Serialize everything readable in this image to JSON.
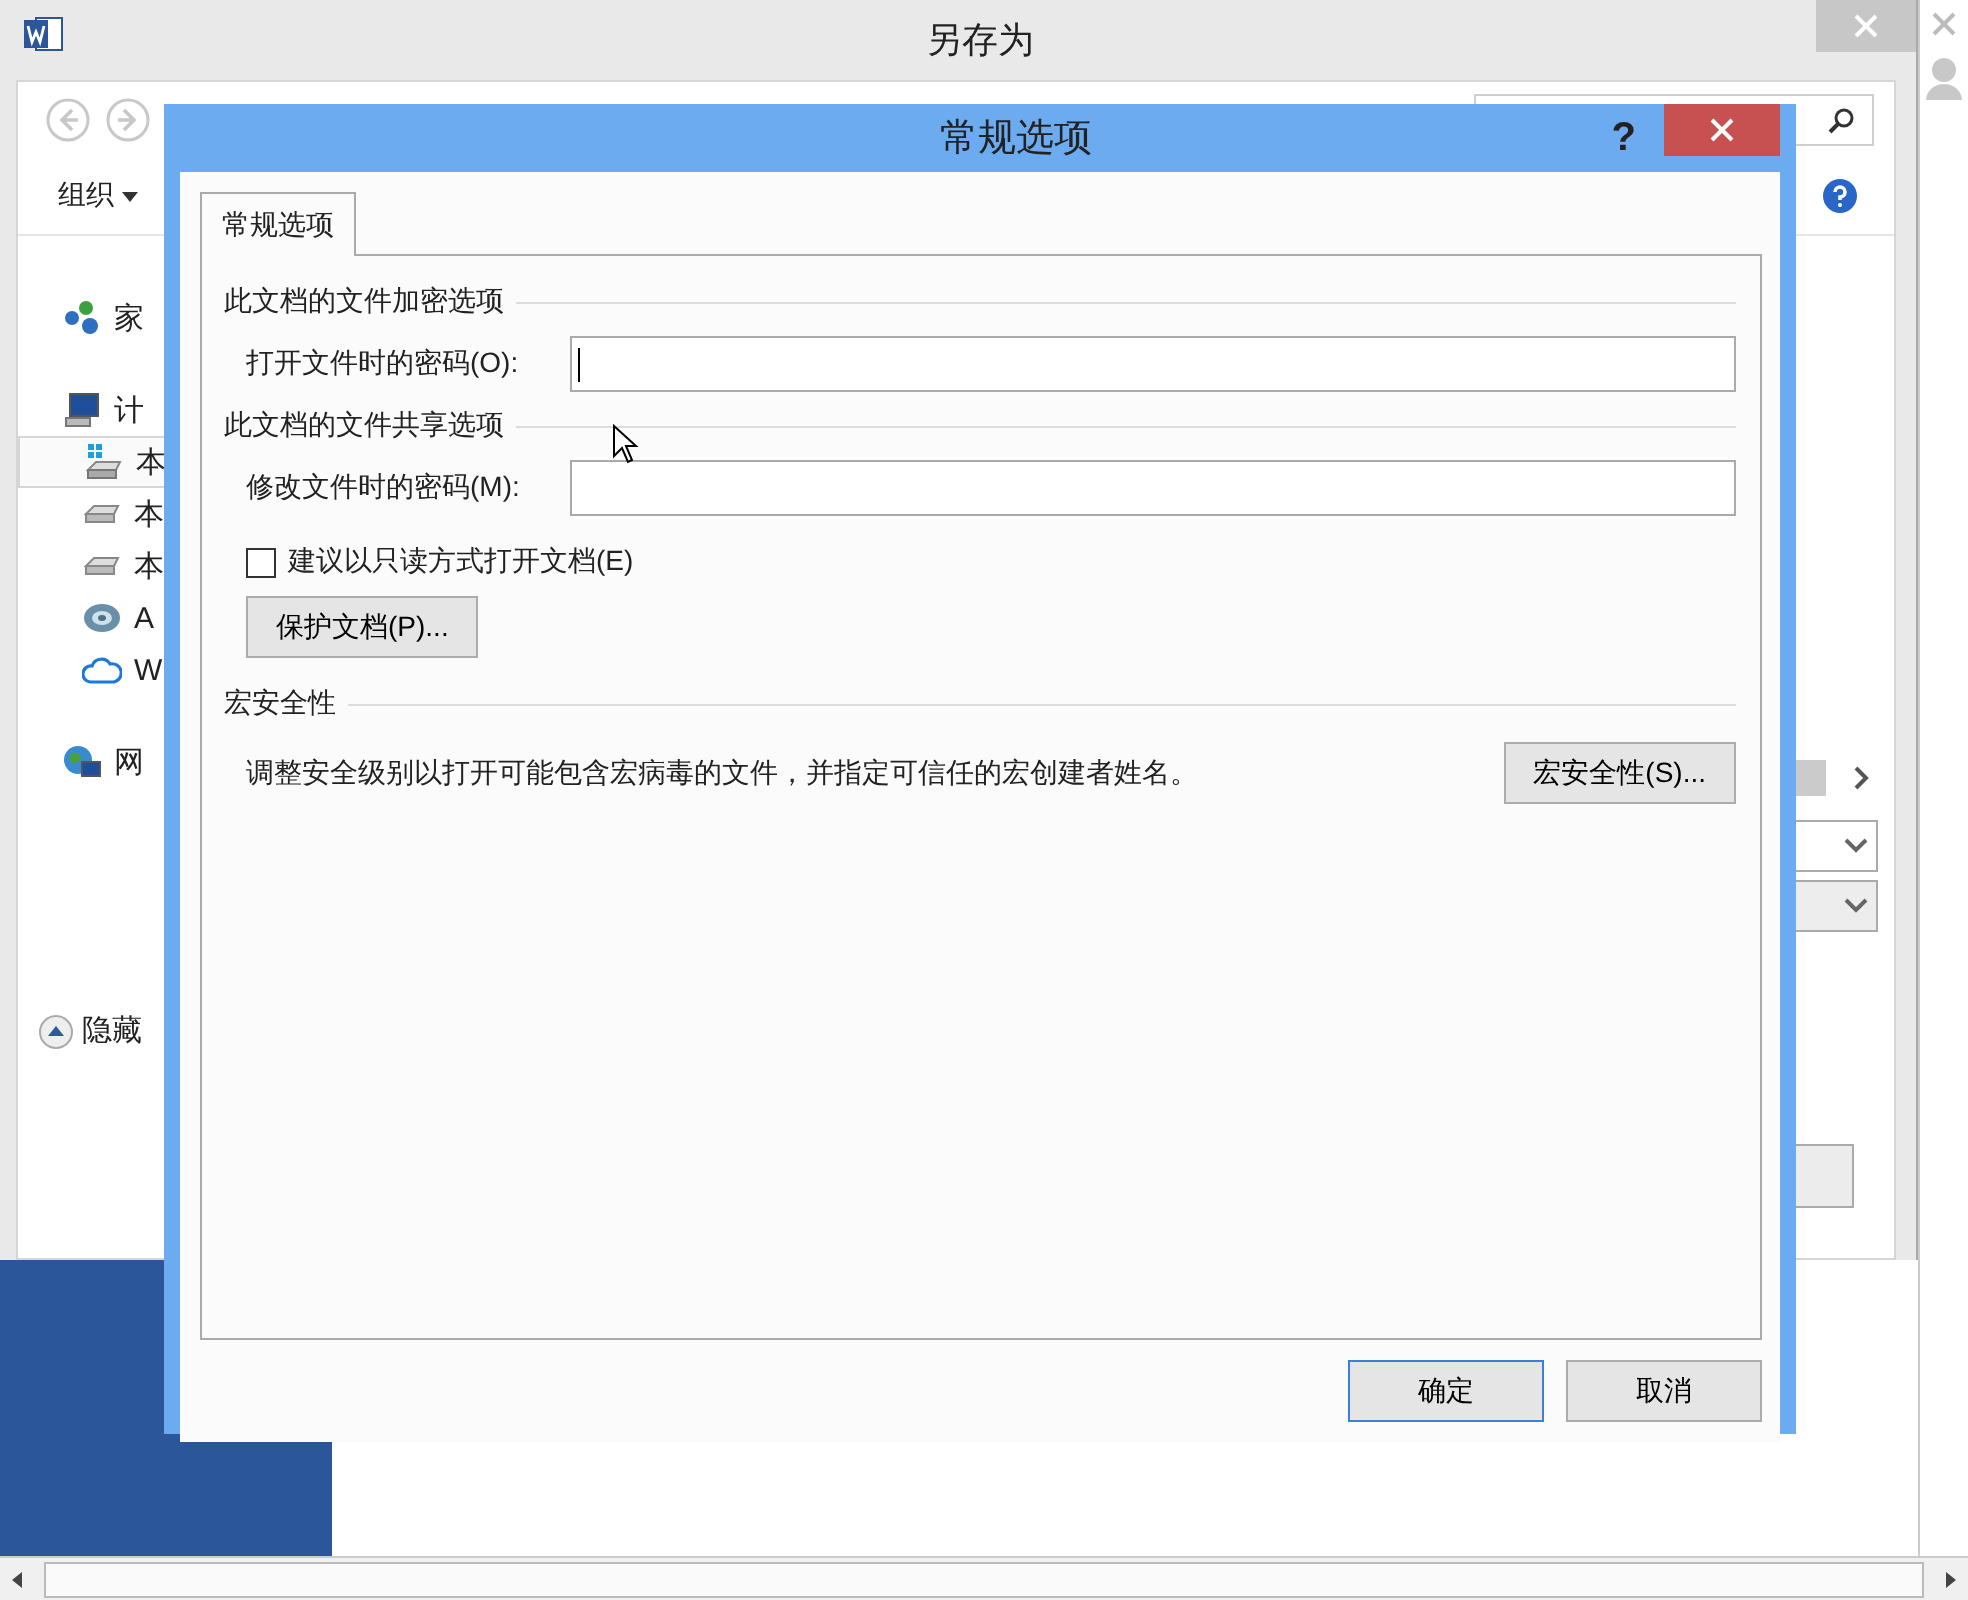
{
  "back_window": {
    "title": "另存为",
    "toolbar": {
      "organize": "组织"
    },
    "sidebar": [
      {
        "label": "家",
        "kind": "homegroup",
        "selected": false
      },
      {
        "label": "计",
        "kind": "computer",
        "selected": false,
        "children": [
          {
            "label": "本",
            "kind": "system-drive",
            "selected": true
          },
          {
            "label": "本",
            "kind": "drive",
            "selected": false
          },
          {
            "label": "本",
            "kind": "drive",
            "selected": false
          },
          {
            "label": "A",
            "kind": "disc",
            "selected": false
          },
          {
            "label": "W",
            "kind": "cloud",
            "selected": false
          }
        ]
      },
      {
        "label": "网",
        "kind": "network",
        "selected": false
      }
    ],
    "hide_folders": "隐藏"
  },
  "dialog": {
    "title": "常规选项",
    "help": "?",
    "tabs": [
      {
        "label": "常规选项",
        "selected": true
      }
    ],
    "encryption": {
      "heading": "此文档的文件加密选项",
      "label": "打开文件时的密码(O):",
      "focused": true
    },
    "sharing": {
      "heading": "此文档的文件共享选项",
      "label": "修改文件时的密码(M):",
      "focused": false,
      "read_only": {
        "label": "建议以只读方式打开文档(E)",
        "checked": false
      },
      "protect_button": "保护文档(P)..."
    },
    "macro": {
      "heading": "宏安全性",
      "description": "调整安全级别以打开可能包含宏病毒的文件，并指定可信任的宏创建者姓名。",
      "button": "宏安全性(S)..."
    },
    "buttons": [
      {
        "label": "确定",
        "default": true
      },
      {
        "label": "取消",
        "default": false
      }
    ]
  }
}
